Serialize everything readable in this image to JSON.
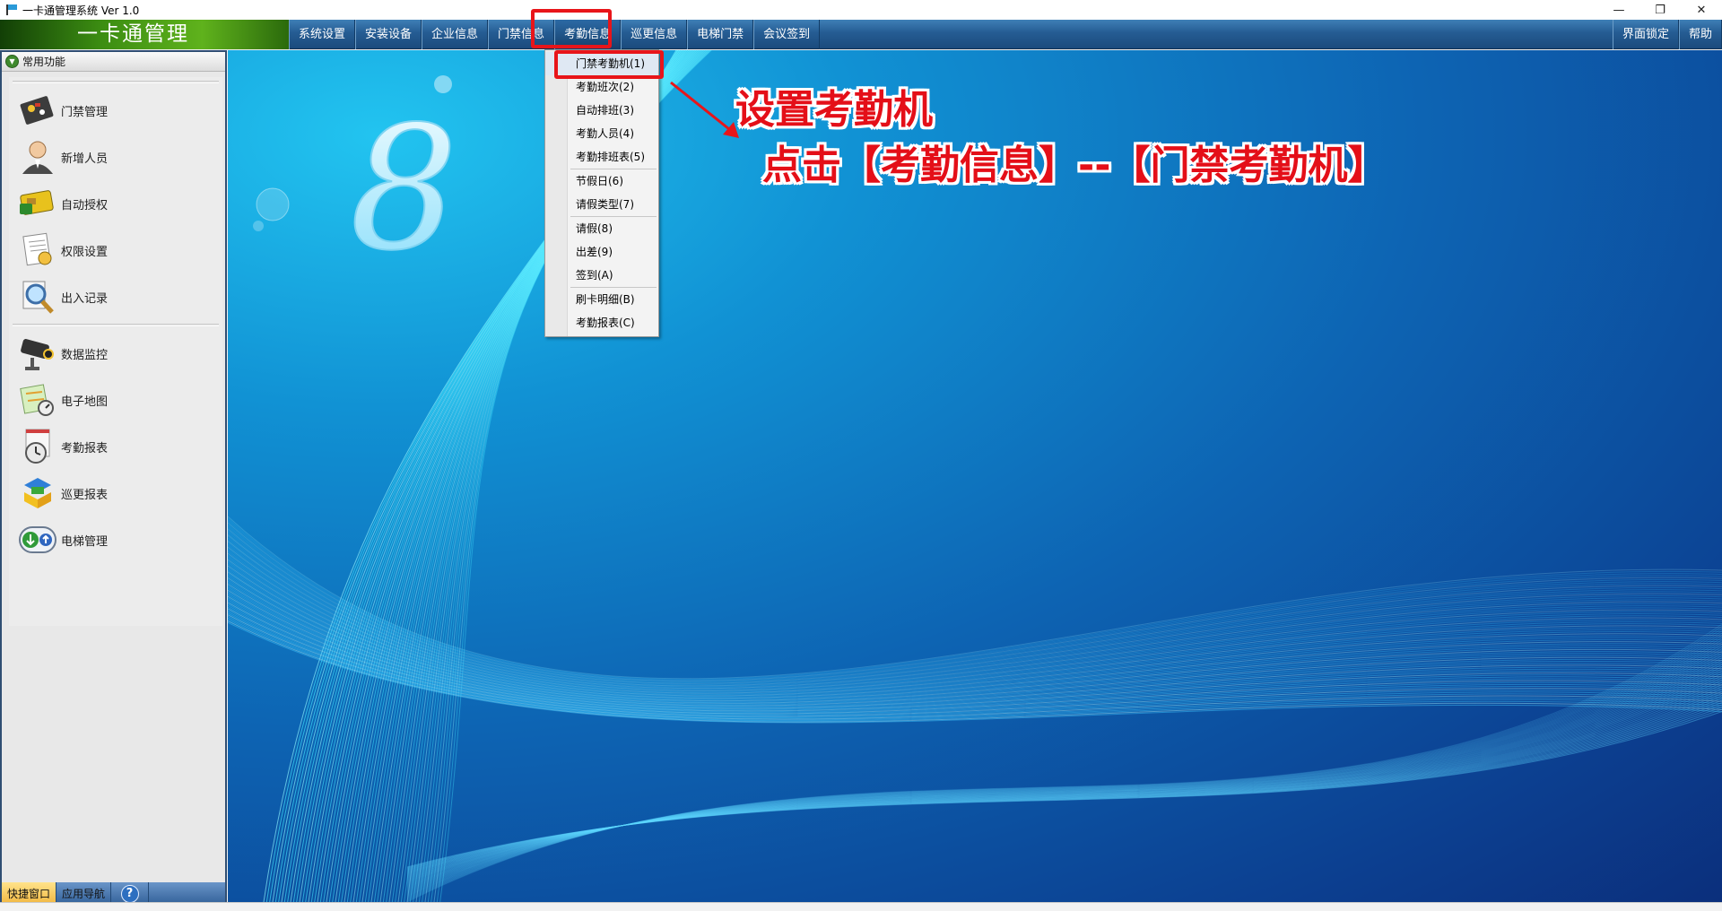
{
  "window": {
    "title": "一卡通管理系统  Ver 1.0",
    "controls": {
      "minimize": "—",
      "restore": "❐",
      "close": "✕"
    }
  },
  "menubar": {
    "brand": "一卡通管理",
    "items": [
      {
        "label": "系统设置"
      },
      {
        "label": "安装设备"
      },
      {
        "label": "企业信息"
      },
      {
        "label": "门禁信息"
      },
      {
        "label": "考勤信息"
      },
      {
        "label": "巡更信息"
      },
      {
        "label": "电梯门禁"
      },
      {
        "label": "会议签到"
      }
    ],
    "right_items": [
      {
        "label": "界面锁定"
      },
      {
        "label": "帮助"
      }
    ]
  },
  "left_panel": {
    "header": "常用功能",
    "group1": [
      {
        "label": "门禁管理",
        "icon": "circuit-board-icon"
      },
      {
        "label": "新增人员",
        "icon": "person-icon"
      },
      {
        "label": "自动授权",
        "icon": "card-icon"
      },
      {
        "label": "权限设置",
        "icon": "document-icon"
      },
      {
        "label": "出入记录",
        "icon": "magnifier-icon"
      }
    ],
    "group2": [
      {
        "label": "数据监控",
        "icon": "camera-icon"
      },
      {
        "label": "电子地图",
        "icon": "map-icon"
      },
      {
        "label": "考勤报表",
        "icon": "clock-icon"
      },
      {
        "label": "巡更报表",
        "icon": "blocks-icon"
      },
      {
        "label": "电梯管理",
        "icon": "elevator-icon"
      }
    ],
    "tabs": [
      {
        "label": "快捷窗口"
      },
      {
        "label": "应用导航"
      }
    ],
    "help": "?"
  },
  "dropdown": {
    "items": [
      {
        "label": "门禁考勤机(1)"
      },
      {
        "label": "考勤班次(2)"
      },
      {
        "label": "自动排班(3)"
      },
      {
        "label": "考勤人员(4)"
      },
      {
        "label": "考勤排班表(5)"
      },
      {
        "label": "节假日(6)"
      },
      {
        "label": "请假类型(7)"
      },
      {
        "label": "请假(8)"
      },
      {
        "label": "出差(9)"
      },
      {
        "label": "签到(A)"
      },
      {
        "label": "刷卡明细(B)"
      },
      {
        "label": "考勤报表(C)"
      }
    ]
  },
  "desktop": {
    "logo": "8"
  },
  "annotation": {
    "line1": "设置考勤机",
    "line2": "点击【考勤信息】--【门禁考勤机】",
    "color": "#e40f18"
  }
}
